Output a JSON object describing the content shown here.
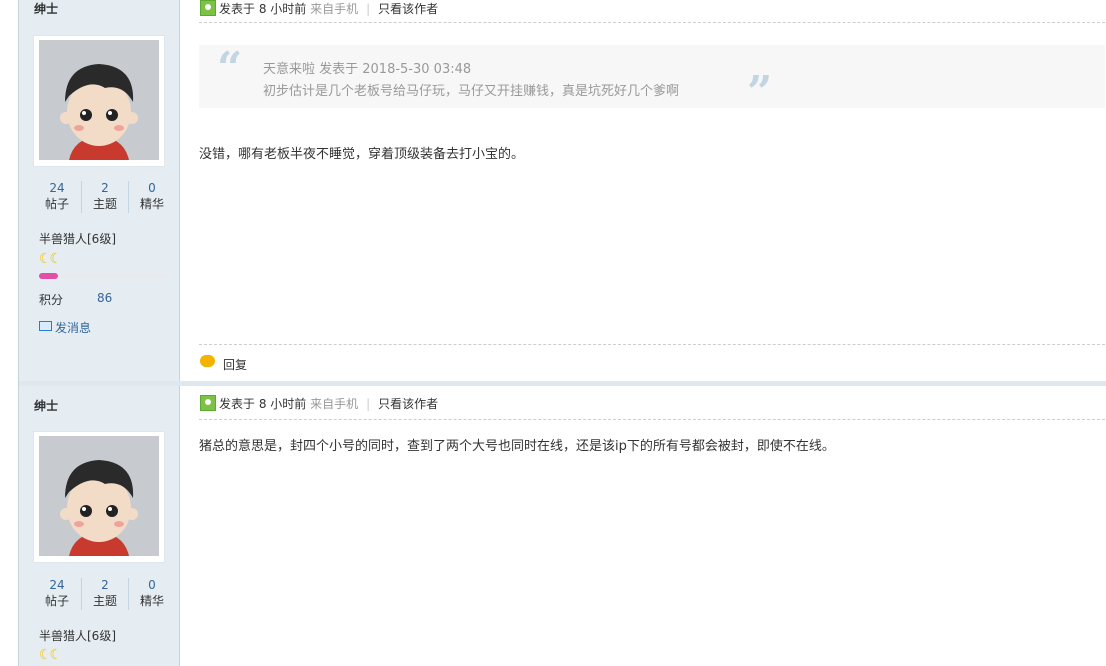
{
  "posts": [
    {
      "author": "绅士",
      "stats": [
        {
          "num": "24",
          "label": "帖子"
        },
        {
          "num": "2",
          "label": "主题"
        },
        {
          "num": "0",
          "label": "精华"
        }
      ],
      "level": "半兽猎人[6级]",
      "level_progress": 0.15,
      "points_label": "积分",
      "points_value": "86",
      "send_msg": "发消息",
      "posted": "发表于 8 小时前",
      "from": "来自手机",
      "author_only": "只看该作者",
      "quote": {
        "header": "天意来啦 发表于 2018-5-30 03:48",
        "text": "初步估计是几个老板号给马仔玩，马仔又开挂赚钱，真是坑死好几个爹啊"
      },
      "body": "没错，哪有老板半夜不睡觉，穿着顶级装备去打小宝的。",
      "reply": "回复"
    },
    {
      "author": "绅士",
      "stats": [
        {
          "num": "24",
          "label": "帖子"
        },
        {
          "num": "2",
          "label": "主题"
        },
        {
          "num": "0",
          "label": "精华"
        }
      ],
      "level": "半兽猎人[6级]",
      "posted": "发表于 8 小时前",
      "from": "来自手机",
      "author_only": "只看该作者",
      "body": "猪总的意思是，封四个小号的同时，查到了两个大号也同时在线，还是该ip下的所有号都会被封，即使不在线。"
    }
  ],
  "colors": {
    "sidebar": "#e5edf2",
    "link": "#336699",
    "accent": "#e24fa8"
  }
}
